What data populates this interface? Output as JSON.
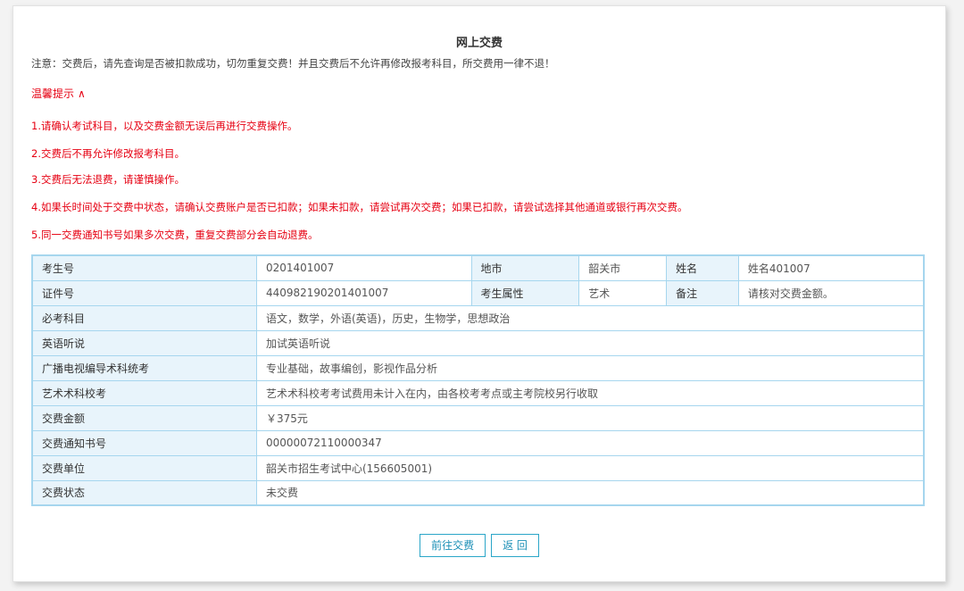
{
  "page": {
    "title": "网上交费",
    "notice": "注意：交费后，请先查询是否被扣款成功，切勿重复交费！并且交费后不允许再修改报考科目，所交费用一律不退！"
  },
  "tips": {
    "header": "温馨提示",
    "toggle_icon": "chevron-up-icon",
    "items": [
      "1.请确认考试科目，以及交费金额无误后再进行交费操作。",
      "2.交费后不再允许修改报考科目。",
      "3.交费后无法退费，请谨慎操作。",
      "4.如果长时间处于交费中状态，请确认交费账户是否已扣款；如果未扣款，请尝试再次交费；如果已扣款，请尝试选择其他通道或银行再次交费。",
      "5.同一交费通知书号如果多次交费，重复交费部分会自动退费。"
    ]
  },
  "info": {
    "row1": {
      "exam_no_label": "考生号",
      "exam_no": "0201401007",
      "city_label": "地市",
      "city": "韶关市",
      "name_label": "姓名",
      "name": "姓名401007"
    },
    "row2": {
      "id_label": "证件号",
      "id": "440982190201401007",
      "attr_label": "考生属性",
      "attr": "艺术",
      "remark_label": "备注",
      "remark": "请核对交费金额。"
    },
    "required_subjects_label": "必考科目",
    "required_subjects": "语文，数学，外语(英语)，历史，生物学，思想政治",
    "listening_label": "英语听说",
    "listening": "加试英语听说",
    "broadcast_label": "广播电视编导术科统考",
    "broadcast": "专业基础，故事编创，影视作品分析",
    "art_school_label": "艺术术科校考",
    "art_school": "艺术术科校考考试费用未计入在内，由各校考考点或主考院校另行收取",
    "fee_label": "交费金额",
    "fee": "￥375元",
    "notice_no_label": "交费通知书号",
    "notice_no": "00000072110000347",
    "unit_label": "交费单位",
    "unit": "韶关市招生考试中心(156605001)",
    "status_label": "交费状态",
    "status": "未交费"
  },
  "buttons": {
    "pay": "前往交费",
    "back": "返 回"
  },
  "colors": {
    "tip_red": "#e60012",
    "table_border": "#a6d6ee",
    "label_bg": "#e8f4fb",
    "button_accent": "#2ba6c8"
  }
}
